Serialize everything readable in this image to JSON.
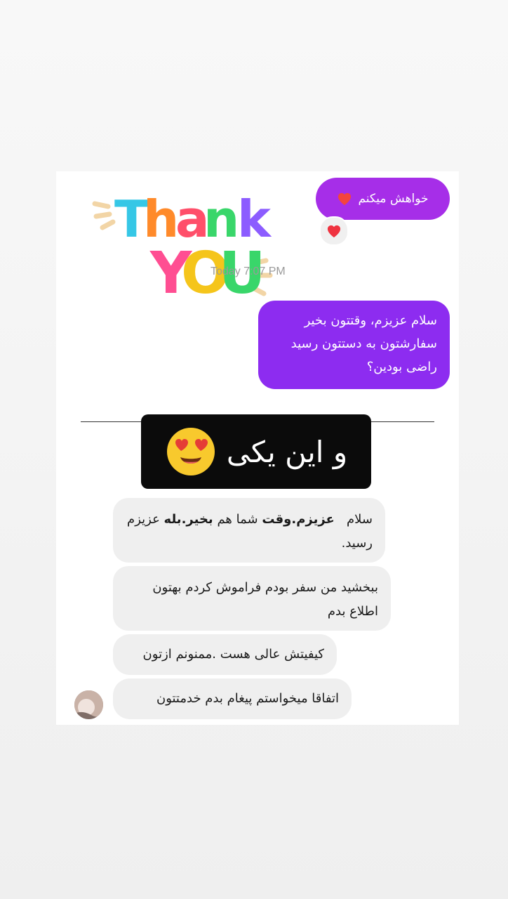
{
  "chat": {
    "timestamp": "Today 7:07 PM",
    "outgoing_reply": {
      "text": "خواهش میکنم"
    },
    "reaction_icon": "heart-icon",
    "thank_you_art": "Thank You",
    "outgoing_message": {
      "line1": "سلام عزیزم، وقتتون بخیر",
      "line2": "سفارشتون به دستتون رسید",
      "line3": "راضی بودین؟"
    },
    "divider": {
      "text": "و این یکی"
    },
    "incoming_messages": [
      {
        "line1_prefix": "سلام",
        "line1_bold_a": "عزیزم.",
        "line1_bold_b": "وقت",
        "line1_mid": "شما هم",
        "line1_bold_c": "بخیر.",
        "line1_bold_d": "بله",
        "line1_suffix": "عزیزم",
        "line2": "رسید."
      },
      {
        "line1": "ببخشید من سفر بودم فراموش کردم بهتون",
        "line2": "اطلاع بدم"
      },
      {
        "text": "کیفیتش عالی هست .ممنونم ازتون"
      },
      {
        "text": "اتفاقا میخواستم پیغام بدم خدمتتون"
      }
    ]
  },
  "colors": {
    "purple_bubble": "#8d2cf0",
    "purple_reply": "#a62ee8",
    "gray_bubble": "#efefef",
    "banner": "#0b0b0b"
  }
}
